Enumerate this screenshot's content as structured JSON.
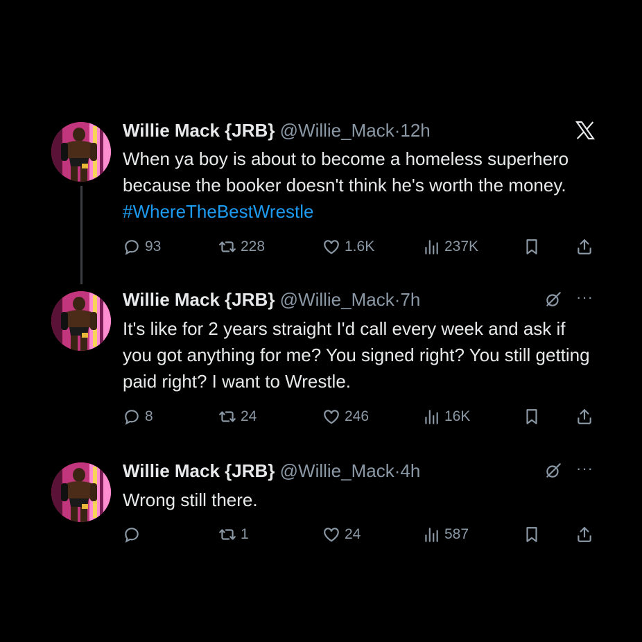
{
  "tweets": [
    {
      "name": "Willie Mack {JRB}",
      "handle": "@Willie_Mack",
      "dot": "·",
      "time": "12h",
      "text": "When ya boy is about to become a homeless superhero because the booker doesn't think he's worth the money.",
      "hashtag": "#WhereTheBestWrestle",
      "replies": "93",
      "reposts": "228",
      "likes": "1.6K",
      "views": "237K"
    },
    {
      "name": "Willie Mack {JRB}",
      "handle": "@Willie_Mack",
      "dot": "·",
      "time": "7h",
      "text": "It's like for 2 years straight I'd call every week and ask if you got anything for me? You signed right? You still getting paid right? I want to Wrestle.",
      "replies": "8",
      "reposts": "24",
      "likes": "246",
      "views": "16K"
    },
    {
      "name": "Willie Mack {JRB}",
      "handle": "@Willie_Mack",
      "dot": "·",
      "time": "4h",
      "text": "Wrong still there.",
      "replies": "",
      "reposts": "1",
      "likes": "24",
      "views": "587"
    }
  ],
  "icons": {
    "logo": "x-logo-icon",
    "reply": "reply-icon",
    "repost": "repost-icon",
    "like": "heart-icon",
    "views": "views-icon",
    "bookmark": "bookmark-icon",
    "share": "share-icon",
    "grok": "grok-icon",
    "more": "more-icon"
  },
  "colors": {
    "background": "#000000",
    "text": "#e7e9ea",
    "muted": "#8b98a5",
    "hashtag": "#1d9bf0"
  }
}
